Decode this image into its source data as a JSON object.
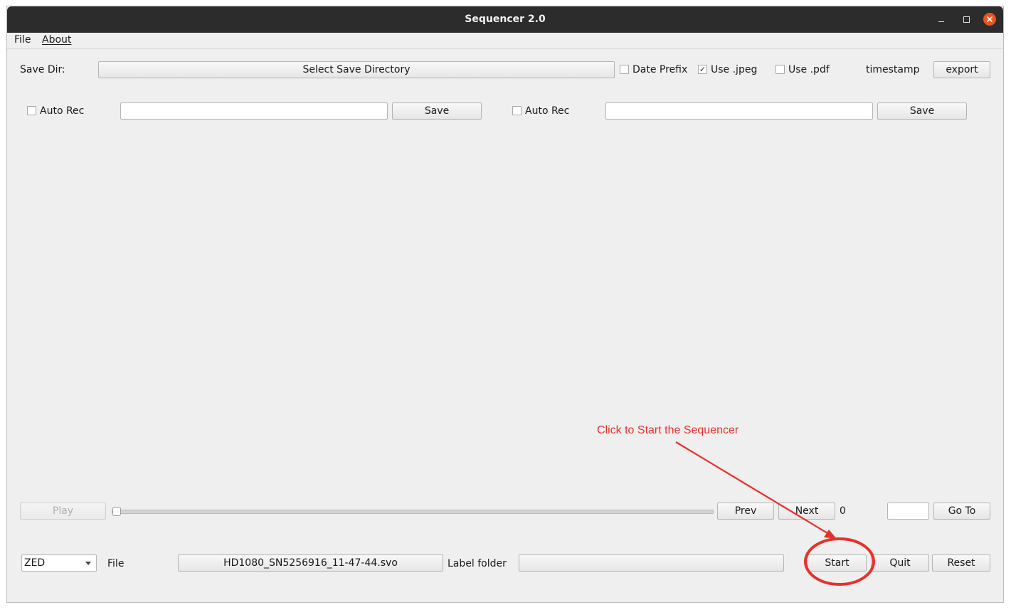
{
  "window": {
    "title": "Sequencer 2.0"
  },
  "menu": {
    "file": "File",
    "about": "About"
  },
  "save_row": {
    "label": "Save Dir:",
    "select_button": "Select Save Directory",
    "date_prefix_label": "Date Prefix",
    "date_prefix_checked": false,
    "use_jpeg_label": "Use .jpeg",
    "use_jpeg_checked": true,
    "use_pdf_label": "Use .pdf",
    "use_pdf_checked": false,
    "timestamp_label": "timestamp",
    "export_button": "export"
  },
  "record_row": {
    "left": {
      "auto_rec_label": "Auto Rec",
      "auto_rec_checked": false,
      "input_value": "",
      "save_button": "Save"
    },
    "right": {
      "auto_rec_label": "Auto Rec",
      "auto_rec_checked": false,
      "input_value": "",
      "save_button": "Save"
    }
  },
  "playback": {
    "play_button": "Play",
    "slider_position": 0,
    "prev_button": "Prev",
    "next_button": "Next",
    "frame_number": "0",
    "goto_value": "",
    "goto_button": "Go To"
  },
  "bottom": {
    "camera_select": "ZED",
    "file_label": "File",
    "file_button": "HD1080_SN5256916_11-47-44.svo",
    "label_folder_label": "Label folder",
    "label_folder_button": "",
    "start_button": "Start",
    "quit_button": "Quit",
    "reset_button": "Reset"
  },
  "annotation": {
    "text": "Click to Start the Sequencer",
    "color": "#e8302a"
  },
  "colors": {
    "titlebar": "#2c2c2c",
    "close_button": "#e95420",
    "window_bg": "#efefef"
  }
}
